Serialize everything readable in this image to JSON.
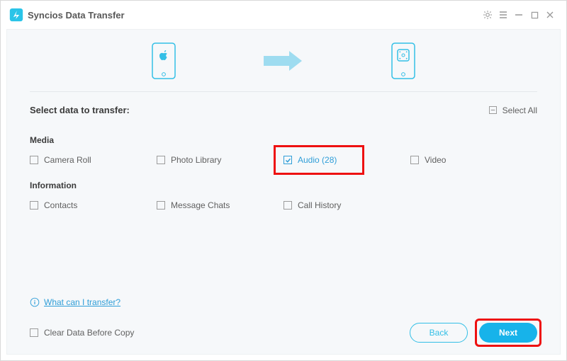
{
  "app": {
    "title": "Syncios Data Transfer"
  },
  "heading": "Select data to transfer:",
  "selectAll": {
    "label": "Select All",
    "checked": false
  },
  "sections": {
    "media": {
      "title": "Media",
      "items": [
        {
          "label": "Camera Roll",
          "checked": false
        },
        {
          "label": "Photo Library",
          "checked": false
        },
        {
          "label": "Audio (28)",
          "checked": true
        },
        {
          "label": "Video",
          "checked": false
        }
      ]
    },
    "information": {
      "title": "Information",
      "items": [
        {
          "label": "Contacts",
          "checked": false
        },
        {
          "label": "Message Chats",
          "checked": false
        },
        {
          "label": "Call History",
          "checked": false
        }
      ]
    }
  },
  "helpLink": "What can I transfer?",
  "clearData": {
    "label": "Clear Data Before Copy",
    "checked": false
  },
  "buttons": {
    "back": "Back",
    "next": "Next"
  }
}
